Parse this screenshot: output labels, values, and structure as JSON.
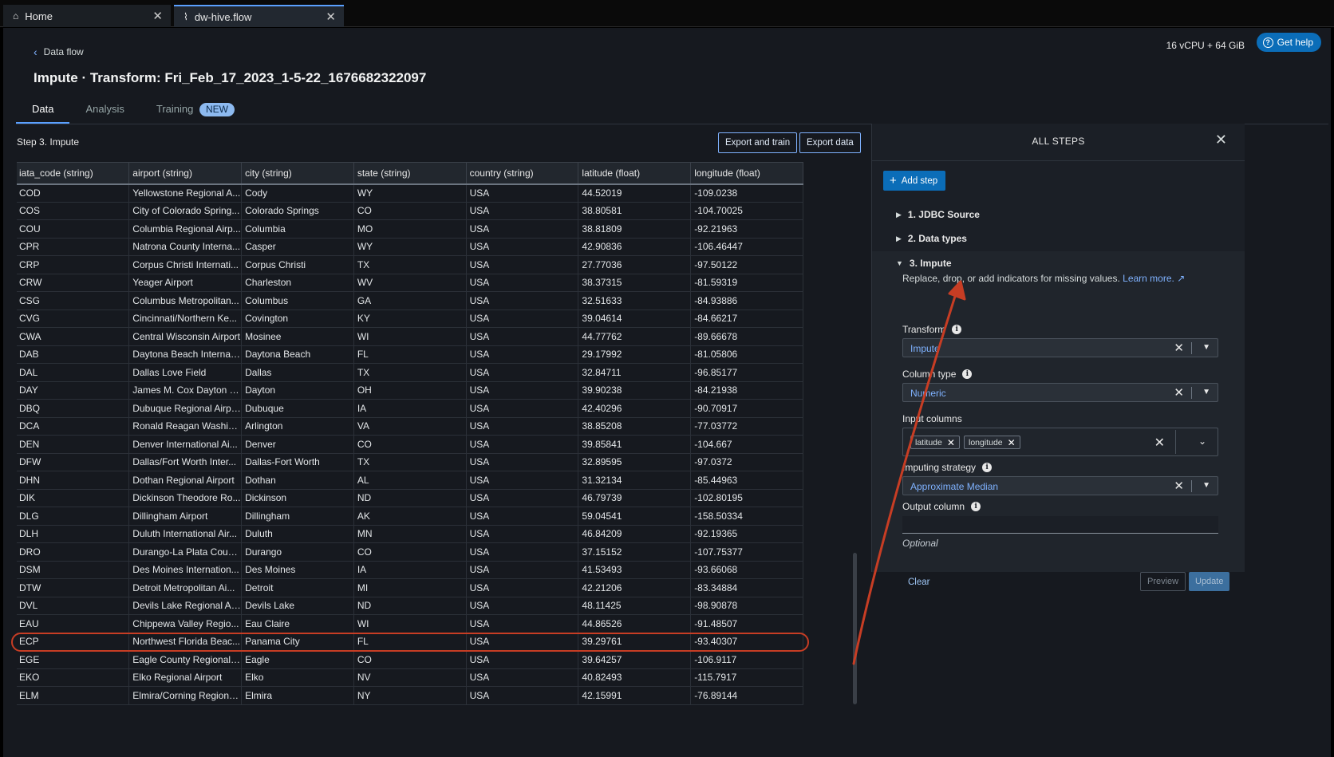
{
  "tabs": [
    {
      "label": "Home",
      "icon": "home-icon"
    },
    {
      "label": "dw-hive.flow",
      "icon": "flow-icon"
    }
  ],
  "header": {
    "back_label": "Data flow",
    "title": "Impute · Transform: Fri_Feb_17_2023_1-5-22_1676682322097",
    "resources": "16 vCPU + 64 GiB",
    "get_help": "Get help"
  },
  "page_tabs": {
    "data": "Data",
    "analysis": "Analysis",
    "training": "Training",
    "training_badge": "NEW"
  },
  "left": {
    "step_label": "Step 3. Impute",
    "export_train": "Export and train",
    "export_data": "Export data"
  },
  "table": {
    "columns": [
      "iata_code (string)",
      "airport (string)",
      "city (string)",
      "state (string)",
      "country (string)",
      "latitude (float)",
      "longitude (float)"
    ],
    "rows": [
      [
        "COD",
        "Yellowstone Regional A...",
        "Cody",
        "WY",
        "USA",
        "44.52019",
        "-109.0238"
      ],
      [
        "COS",
        "City of Colorado Spring...",
        "Colorado Springs",
        "CO",
        "USA",
        "38.80581",
        "-104.70025"
      ],
      [
        "COU",
        "Columbia Regional Airp...",
        "Columbia",
        "MO",
        "USA",
        "38.81809",
        "-92.21963"
      ],
      [
        "CPR",
        "Natrona County Interna...",
        "Casper",
        "WY",
        "USA",
        "42.90836",
        "-106.46447"
      ],
      [
        "CRP",
        "Corpus Christi Internati...",
        "Corpus Christi",
        "TX",
        "USA",
        "27.77036",
        "-97.50122"
      ],
      [
        "CRW",
        "Yeager Airport",
        "Charleston",
        "WV",
        "USA",
        "38.37315",
        "-81.59319"
      ],
      [
        "CSG",
        "Columbus Metropolitan...",
        "Columbus",
        "GA",
        "USA",
        "32.51633",
        "-84.93886"
      ],
      [
        "CVG",
        "Cincinnati/Northern Ke...",
        "Covington",
        "KY",
        "USA",
        "39.04614",
        "-84.66217"
      ],
      [
        "CWA",
        "Central Wisconsin Airport",
        "Mosinee",
        "WI",
        "USA",
        "44.77762",
        "-89.66678"
      ],
      [
        "DAB",
        "Daytona Beach Internat...",
        "Daytona Beach",
        "FL",
        "USA",
        "29.17992",
        "-81.05806"
      ],
      [
        "DAL",
        "Dallas Love Field",
        "Dallas",
        "TX",
        "USA",
        "32.84711",
        "-96.85177"
      ],
      [
        "DAY",
        "James M. Cox Dayton In...",
        "Dayton",
        "OH",
        "USA",
        "39.90238",
        "-84.21938"
      ],
      [
        "DBQ",
        "Dubuque Regional Airport",
        "Dubuque",
        "IA",
        "USA",
        "42.40296",
        "-90.70917"
      ],
      [
        "DCA",
        "Ronald Reagan Washin...",
        "Arlington",
        "VA",
        "USA",
        "38.85208",
        "-77.03772"
      ],
      [
        "DEN",
        "Denver International Ai...",
        "Denver",
        "CO",
        "USA",
        "39.85841",
        "-104.667"
      ],
      [
        "DFW",
        "Dallas/Fort Worth Inter...",
        "Dallas-Fort Worth",
        "TX",
        "USA",
        "32.89595",
        "-97.0372"
      ],
      [
        "DHN",
        "Dothan Regional Airport",
        "Dothan",
        "AL",
        "USA",
        "31.32134",
        "-85.44963"
      ],
      [
        "DIK",
        "Dickinson Theodore Ro...",
        "Dickinson",
        "ND",
        "USA",
        "46.79739",
        "-102.80195"
      ],
      [
        "DLG",
        "Dillingham Airport",
        "Dillingham",
        "AK",
        "USA",
        "59.04541",
        "-158.50334"
      ],
      [
        "DLH",
        "Duluth International Air...",
        "Duluth",
        "MN",
        "USA",
        "46.84209",
        "-92.19365"
      ],
      [
        "DRO",
        "Durango-La Plata Coun...",
        "Durango",
        "CO",
        "USA",
        "37.15152",
        "-107.75377"
      ],
      [
        "DSM",
        "Des Moines Internation...",
        "Des Moines",
        "IA",
        "USA",
        "41.53493",
        "-93.66068"
      ],
      [
        "DTW",
        "Detroit Metropolitan Ai...",
        "Detroit",
        "MI",
        "USA",
        "42.21206",
        "-83.34884"
      ],
      [
        "DVL",
        "Devils Lake Regional Air...",
        "Devils Lake",
        "ND",
        "USA",
        "48.11425",
        "-98.90878"
      ],
      [
        "EAU",
        "Chippewa Valley Regio...",
        "Eau Claire",
        "WI",
        "USA",
        "44.86526",
        "-91.48507"
      ],
      [
        "ECP",
        "Northwest Florida Beac...",
        "Panama City",
        "FL",
        "USA",
        "39.29761",
        "-93.40307"
      ],
      [
        "EGE",
        "Eagle County Regional ...",
        "Eagle",
        "CO",
        "USA",
        "39.64257",
        "-106.9117"
      ],
      [
        "EKO",
        "Elko Regional Airport",
        "Elko",
        "NV",
        "USA",
        "40.82493",
        "-115.7917"
      ],
      [
        "ELM",
        "Elmira/Corning Regiona...",
        "Elmira",
        "NY",
        "USA",
        "42.15991",
        "-76.89144"
      ]
    ]
  },
  "steps_panel": {
    "title": "ALL STEPS",
    "add_step": "Add step",
    "steps": [
      "1. JDBC Source",
      "2. Data types",
      "3. Impute"
    ],
    "description": "Replace, drop, or add indicators for missing values.",
    "learn_more": "Learn more.",
    "transform_label": "Transform",
    "transform_value": "Impute",
    "column_type_label": "Column type",
    "column_type_value": "Numeric",
    "input_columns_label": "Input columns",
    "input_columns": [
      "latitude",
      "longitude"
    ],
    "imputing_strategy_label": "Imputing strategy",
    "imputing_strategy_value": "Approximate Median",
    "output_column_label": "Output column",
    "output_column_hint": "Optional",
    "clear": "Clear",
    "preview": "Preview",
    "update": "Update"
  },
  "colors": {
    "accent": "#0b6db8",
    "link": "#7fb2ff",
    "annotation": "#c73d24"
  }
}
